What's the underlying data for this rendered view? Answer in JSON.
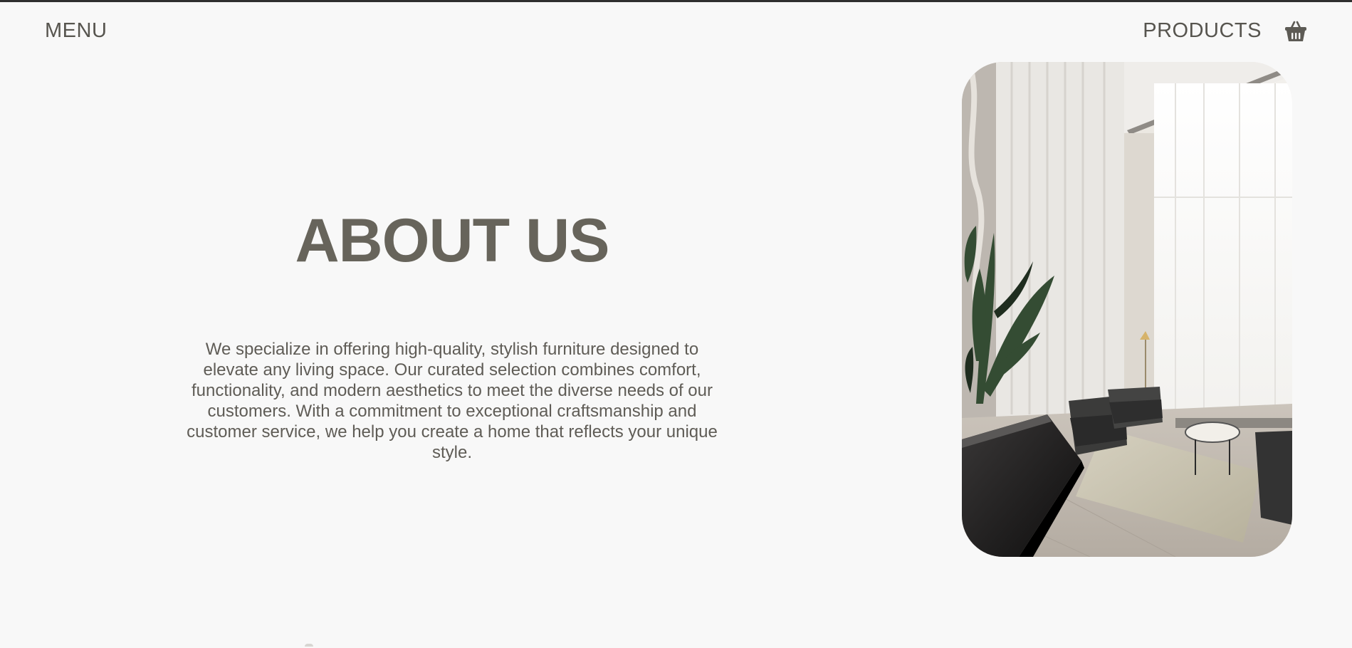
{
  "nav": {
    "menu_label": "MENU",
    "products_label": "PRODUCTS",
    "cart_icon": "basket-icon"
  },
  "hero": {
    "title": "ABOUT US",
    "description": "We specialize in offering high-quality, stylish furniture designed to elevate any living space. Our curated selection combines comfort, functionality, and modern aesthetics to meet the diverse needs of our customers. With a commitment to exceptional craftsmanship and customer service, we help you create a home that reflects your unique style.",
    "image": "showroom-lounge-photo"
  },
  "colors": {
    "background": "#f8f8f8",
    "heading": "#67645b",
    "text": "#5f5c56"
  }
}
